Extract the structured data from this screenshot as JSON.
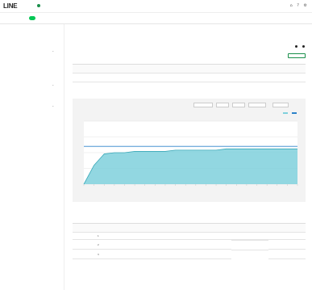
{
  "header": {
    "logo": "LINE",
    "logo_sub": "",
    "breadcrumb": "",
    "icons": [
      "bell-icon",
      "help-icon",
      "settings-icon"
    ]
  },
  "tabs": {
    "items": [
      {
        "label": ""
      },
      {
        "label": ""
      },
      {
        "label": ""
      },
      {
        "label": ""
      },
      {
        "label": ""
      },
      {
        "label": ""
      },
      {
        "label": ""
      }
    ],
    "right_label": ""
  },
  "sidebar": {
    "items": [
      {
        "label": ""
      },
      {
        "label": ""
      },
      {
        "label": ""
      },
      {
        "label": ""
      },
      {
        "label": ""
      },
      {
        "label": ""
      },
      {
        "label": ""
      },
      {
        "label": ""
      },
      {
        "label": ""
      },
      {
        "label": ""
      },
      {
        "label": ""
      },
      {
        "label": ""
      },
      {
        "label": ""
      }
    ]
  },
  "main": {
    "title": "",
    "subhead": "",
    "radio_a": "",
    "radio_b": "",
    "section_label": "",
    "export_label": "",
    "summary_headers": [
      "",
      "",
      "",
      ""
    ],
    "summary_row": [
      "",
      "",
      "",
      ""
    ],
    "chart_buttons": [
      "",
      "",
      "",
      "",
      ""
    ],
    "legend": [
      "",
      ""
    ],
    "section2_title": "",
    "msg_headers": [
      "",
      "",
      "",
      ""
    ],
    "msg_rows": [
      {
        "no": "1",
        "lines": [
          "",
          "",
          "",
          "",
          "",
          ""
        ],
        "type": "",
        "count": ""
      },
      {
        "no": "2",
        "lines": [
          ""
        ],
        "type": "",
        "count": ""
      },
      {
        "no": "3",
        "lines": [
          ""
        ],
        "type": "",
        "count": ""
      }
    ]
  },
  "colors": {
    "accent": "#06c755",
    "chart_fill": "#7fd0dc",
    "chart_line": "#2c82c9"
  },
  "chart_data": {
    "type": "area",
    "title": "",
    "series": [
      {
        "values": [
          0,
          15,
          24,
          25,
          25,
          26,
          26,
          26,
          26,
          27,
          27,
          27,
          27,
          27,
          28,
          28,
          28,
          28,
          28,
          28,
          28,
          28
        ]
      },
      {
        "values": [
          30,
          30,
          30,
          30,
          30,
          30,
          30,
          30,
          30,
          30,
          30,
          30,
          30,
          30,
          30,
          30,
          30,
          30,
          30,
          30,
          30,
          30
        ]
      }
    ],
    "ylim": [
      0,
      50
    ],
    "grid": true,
    "legend": "top-right"
  }
}
